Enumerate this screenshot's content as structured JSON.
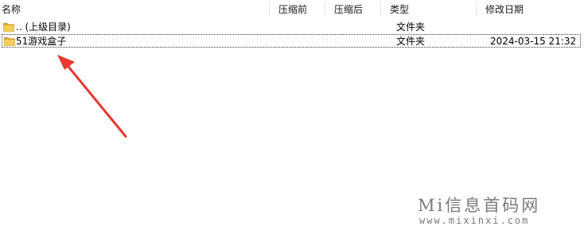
{
  "columns": {
    "name": "名称",
    "compressed": "压缩前",
    "uncompressed": "压缩后",
    "type": "类型",
    "modified": "修改日期"
  },
  "rows": [
    {
      "name": ".. (上级目录)",
      "type": "文件夹",
      "modified": ""
    },
    {
      "name": "51游戏盒子",
      "type": "文件夹",
      "modified": "2024-03-15 21:32"
    }
  ],
  "icons": {
    "folder": "folder-icon"
  },
  "colors": {
    "arrow": "#e8382f",
    "folder_body": "#f1c34a",
    "watermark": "#7a7a7a"
  },
  "watermark": {
    "title": "Mi信息首码网",
    "url": "www.mixinxi.com"
  }
}
